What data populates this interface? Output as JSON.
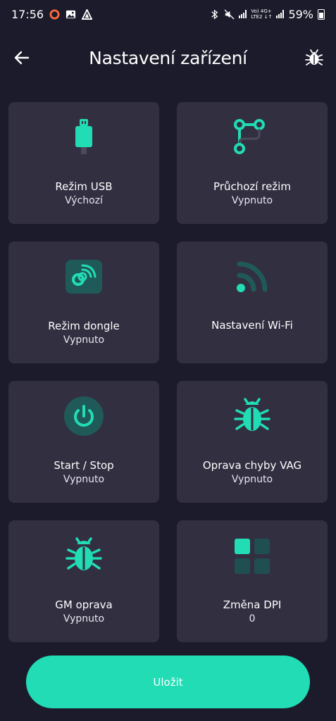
{
  "status_bar": {
    "time": "17:56",
    "network_top": "Vo) 4G+",
    "network_bottom": "LTE2 ↓↑",
    "battery": "59%"
  },
  "header": {
    "title": "Nastavení zařízení",
    "back_icon": "back-arrow-icon",
    "right_icon": "bug-icon"
  },
  "accent_color": "#21dcb4",
  "tiles": [
    {
      "label": "Režim USB",
      "value": "Výchozí",
      "icon": "usb-icon"
    },
    {
      "label": "Průchozí režim",
      "value": "Vypnuto",
      "icon": "passthrough-icon"
    },
    {
      "label": "Režim dongle",
      "value": "Vypnuto",
      "icon": "dongle-icon"
    },
    {
      "label": "Nastavení Wi-Fi",
      "value": "",
      "icon": "wifi-icon"
    },
    {
      "label": "Start / Stop",
      "value": "Vypnuto",
      "icon": "power-icon"
    },
    {
      "label": "Oprava chyby VAG",
      "value": "Vypnuto",
      "icon": "bug-icon"
    },
    {
      "label": "GM oprava",
      "value": "Vypnuto",
      "icon": "bug-icon"
    },
    {
      "label": "Změna DPI",
      "value": "0",
      "icon": "grid-icon"
    }
  ],
  "save_label": "Uložit"
}
